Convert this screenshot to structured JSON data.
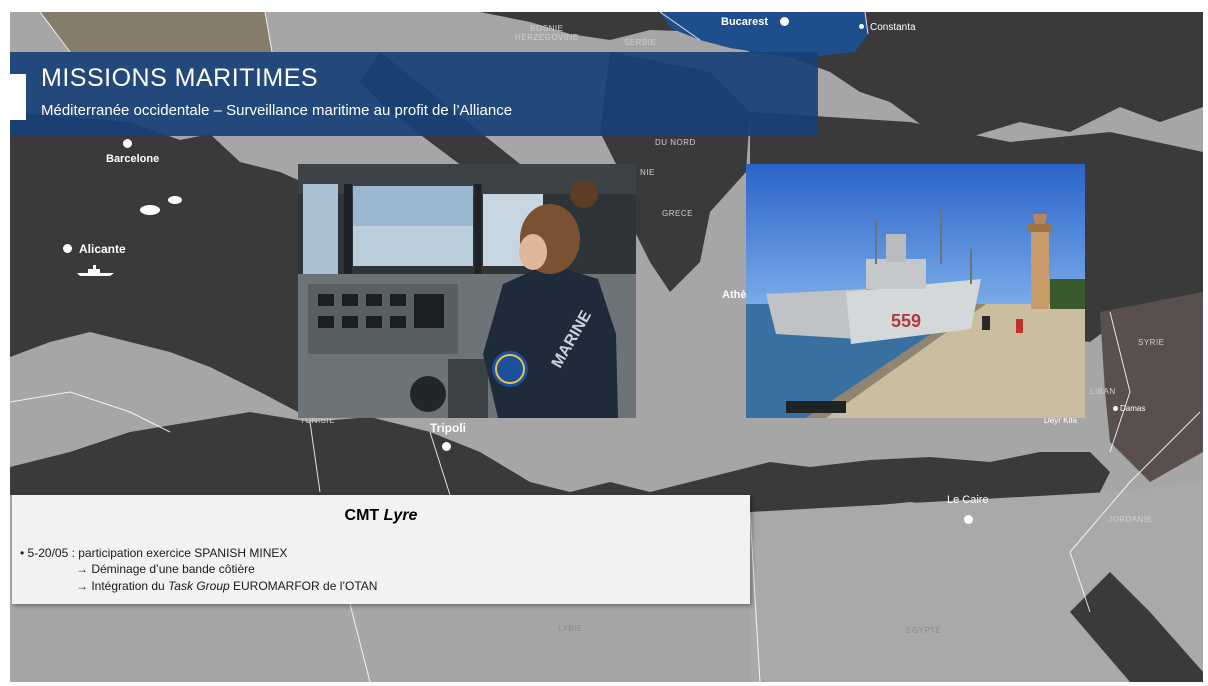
{
  "slide": {
    "title": "MISSIONS MARITIMES",
    "subtitle": "Méditerranée occidentale – Surveillance maritime au profit de l’Alliance"
  },
  "map": {
    "colors": {
      "sea": "#a6a6a6",
      "land": "#3a3a3a",
      "highlight_country": "#1f4e8c",
      "syria": "#5a4f4f",
      "boundary": "#ffffff"
    },
    "cities": {
      "bucarest": "Bucarest",
      "constanta": "Constanta",
      "barcelone": "Barcelone",
      "alicante": "Alicante",
      "tripoli": "Tripoli",
      "athenes": "Athè",
      "le_caire": "Le Caire",
      "damas": "Damas",
      "deyr_kifa": "Deyr Kifa"
    },
    "countries": {
      "bosnie": "BOSNIE\nHERZEGOVINE",
      "serbie": "SERBIE",
      "du_nord": "DU NORD",
      "nie": "NIE",
      "grece": "GRECE",
      "syrie": "SYRIE",
      "liban": "LIBAN",
      "jordanie": "JORDANIE",
      "libye": "LYBIE",
      "egypte": "EGYPTE",
      "tunisie": "TUNISIE"
    },
    "ship_icon": "minehunter-ship-icon"
  },
  "photos": {
    "bridge": {
      "icon": "ship-bridge-photo",
      "patch_text": "MARINE NATIONALE"
    },
    "harbor": {
      "icon": "harbor-minehunters-photo",
      "hull_number": "559"
    }
  },
  "info_box": {
    "title_prefix": "CMT",
    "title_name": "Lyre",
    "bullet": "•",
    "line1": "5-20/05 : participation exercice SPANISH MINEX",
    "arrow": "→",
    "line2": "Déminage d’une bande côtière",
    "line3_pre": "Intégration du",
    "line3_italic": "Task Group",
    "line3_post": "EUROMARFOR de l’OTAN"
  }
}
